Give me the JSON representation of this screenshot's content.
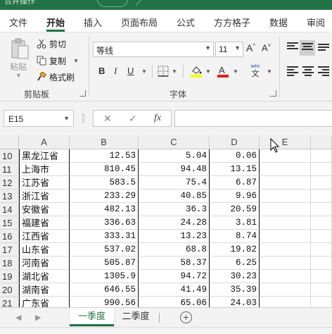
{
  "window": {
    "title": "合并操作"
  },
  "tabs": [
    "文件",
    "开始",
    "插入",
    "页面布局",
    "公式",
    "方方格子",
    "数据",
    "审阅"
  ],
  "clipboard": {
    "paste": "粘贴",
    "cut": "剪切",
    "copy": "复制",
    "format_painter": "格式刷",
    "group_label": "剪贴板"
  },
  "font": {
    "name": "等线",
    "size": "11",
    "grow": "A^",
    "shrink": "A˅",
    "bold": "B",
    "italic": "I",
    "underline": "U",
    "phonetic_top": "wén",
    "phonetic_bottom": "文",
    "group_label": "字体",
    "fill_color": "#ffff00",
    "font_color": "#ff0000"
  },
  "formula_bar": {
    "name_box": "E15",
    "cancel": "✕",
    "enter": "✓",
    "fx": "fx",
    "content": ""
  },
  "columns": [
    "A",
    "B",
    "C",
    "D",
    "E"
  ],
  "rows": [
    {
      "n": "10",
      "a": "黑龙江省",
      "b": "12.53",
      "c": "5.04",
      "d": "0.06"
    },
    {
      "n": "11",
      "a": "上海市",
      "b": "810.45",
      "c": "94.48",
      "d": "13.15"
    },
    {
      "n": "12",
      "a": "江苏省",
      "b": "583.5",
      "c": "75.4",
      "d": "6.87"
    },
    {
      "n": "13",
      "a": "浙江省",
      "b": "233.29",
      "c": "40.85",
      "d": "9.96"
    },
    {
      "n": "14",
      "a": "安徽省",
      "b": "482.13",
      "c": "36.3",
      "d": "20.59"
    },
    {
      "n": "15",
      "a": "福建省",
      "b": "336.63",
      "c": "24.28",
      "d": "3.81"
    },
    {
      "n": "16",
      "a": "江西省",
      "b": "333.31",
      "c": "13.23",
      "d": "8.74"
    },
    {
      "n": "17",
      "a": "山东省",
      "b": "537.02",
      "c": "68.8",
      "d": "19.82"
    },
    {
      "n": "18",
      "a": "河南省",
      "b": "505.87",
      "c": "58.37",
      "d": "6.25"
    },
    {
      "n": "19",
      "a": "湖北省",
      "b": "1305.9",
      "c": "94.72",
      "d": "30.23"
    },
    {
      "n": "20",
      "a": "湖南省",
      "b": "646.55",
      "c": "41.49",
      "d": "35.39"
    },
    {
      "n": "21",
      "a": "广东省",
      "b": "990.56",
      "c": "65.06",
      "d": "24.03"
    }
  ],
  "sheets": {
    "active": "一季度",
    "other": "二季度",
    "add": "+"
  },
  "colors": {
    "accent": "#217346"
  }
}
